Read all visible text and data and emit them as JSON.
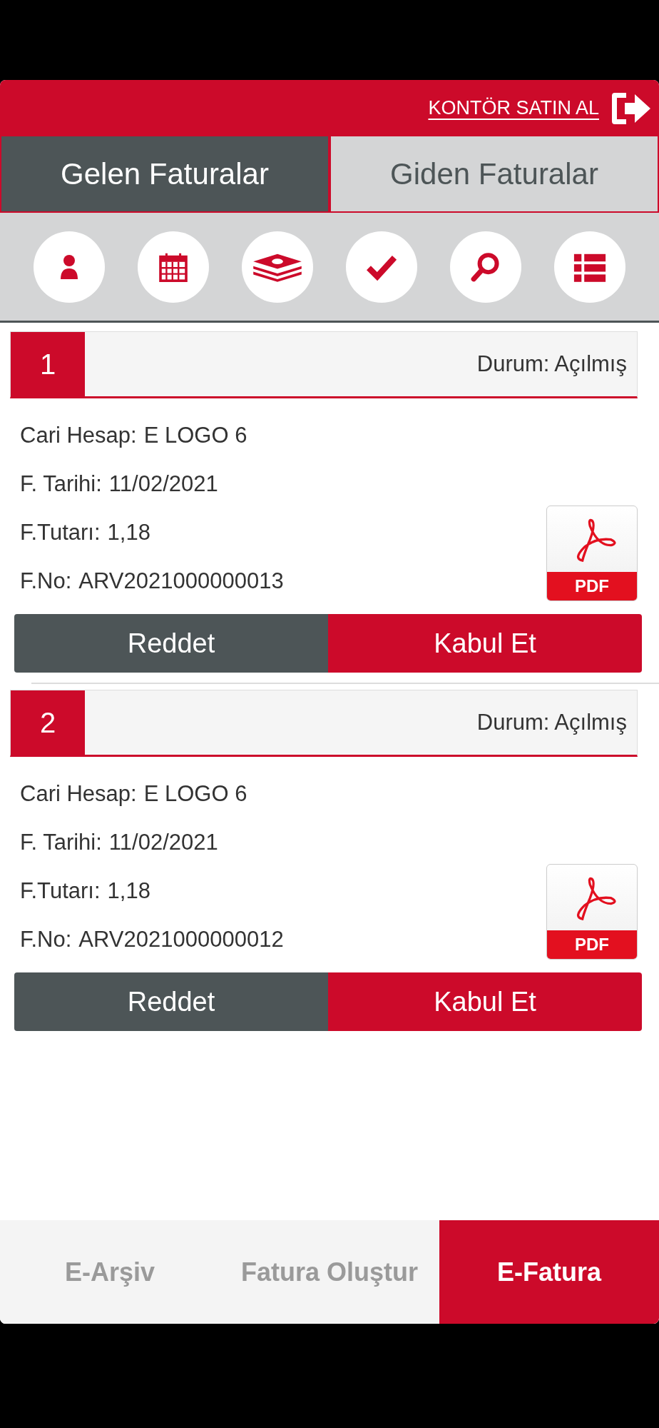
{
  "header": {
    "link": "KONTÖR SATIN AL"
  },
  "tabs": [
    {
      "label": "Gelen Faturalar",
      "selected": true
    },
    {
      "label": "Giden Faturalar",
      "selected": false
    }
  ],
  "invoices": [
    {
      "number": "1",
      "status": "Durum: Açılmış",
      "fields": [
        {
          "label": "Cari Hesap:",
          "value": "E LOGO 6"
        },
        {
          "label": "F. Tarihi:",
          "value": "11/02/2021"
        },
        {
          "label": "F.Tutarı:",
          "value": "1,18"
        },
        {
          "label": "F.No:",
          "value": "ARV2021000000013"
        }
      ],
      "pdf_label": "PDF",
      "reject": "Reddet",
      "accept": "Kabul Et"
    },
    {
      "number": "2",
      "status": "Durum: Açılmış",
      "fields": [
        {
          "label": "Cari Hesap:",
          "value": "E LOGO 6"
        },
        {
          "label": "F. Tarihi:",
          "value": "11/02/2021"
        },
        {
          "label": "F.Tutarı:",
          "value": "1,18"
        },
        {
          "label": "F.No:",
          "value": "ARV2021000000012"
        }
      ],
      "pdf_label": "PDF",
      "reject": "Reddet",
      "accept": "Kabul Et"
    }
  ],
  "bottom_nav": [
    {
      "label": "E-Arşiv",
      "selected": false
    },
    {
      "label": "Fatura Oluştur",
      "selected": false
    },
    {
      "label": "E-Fatura",
      "selected": true
    }
  ]
}
